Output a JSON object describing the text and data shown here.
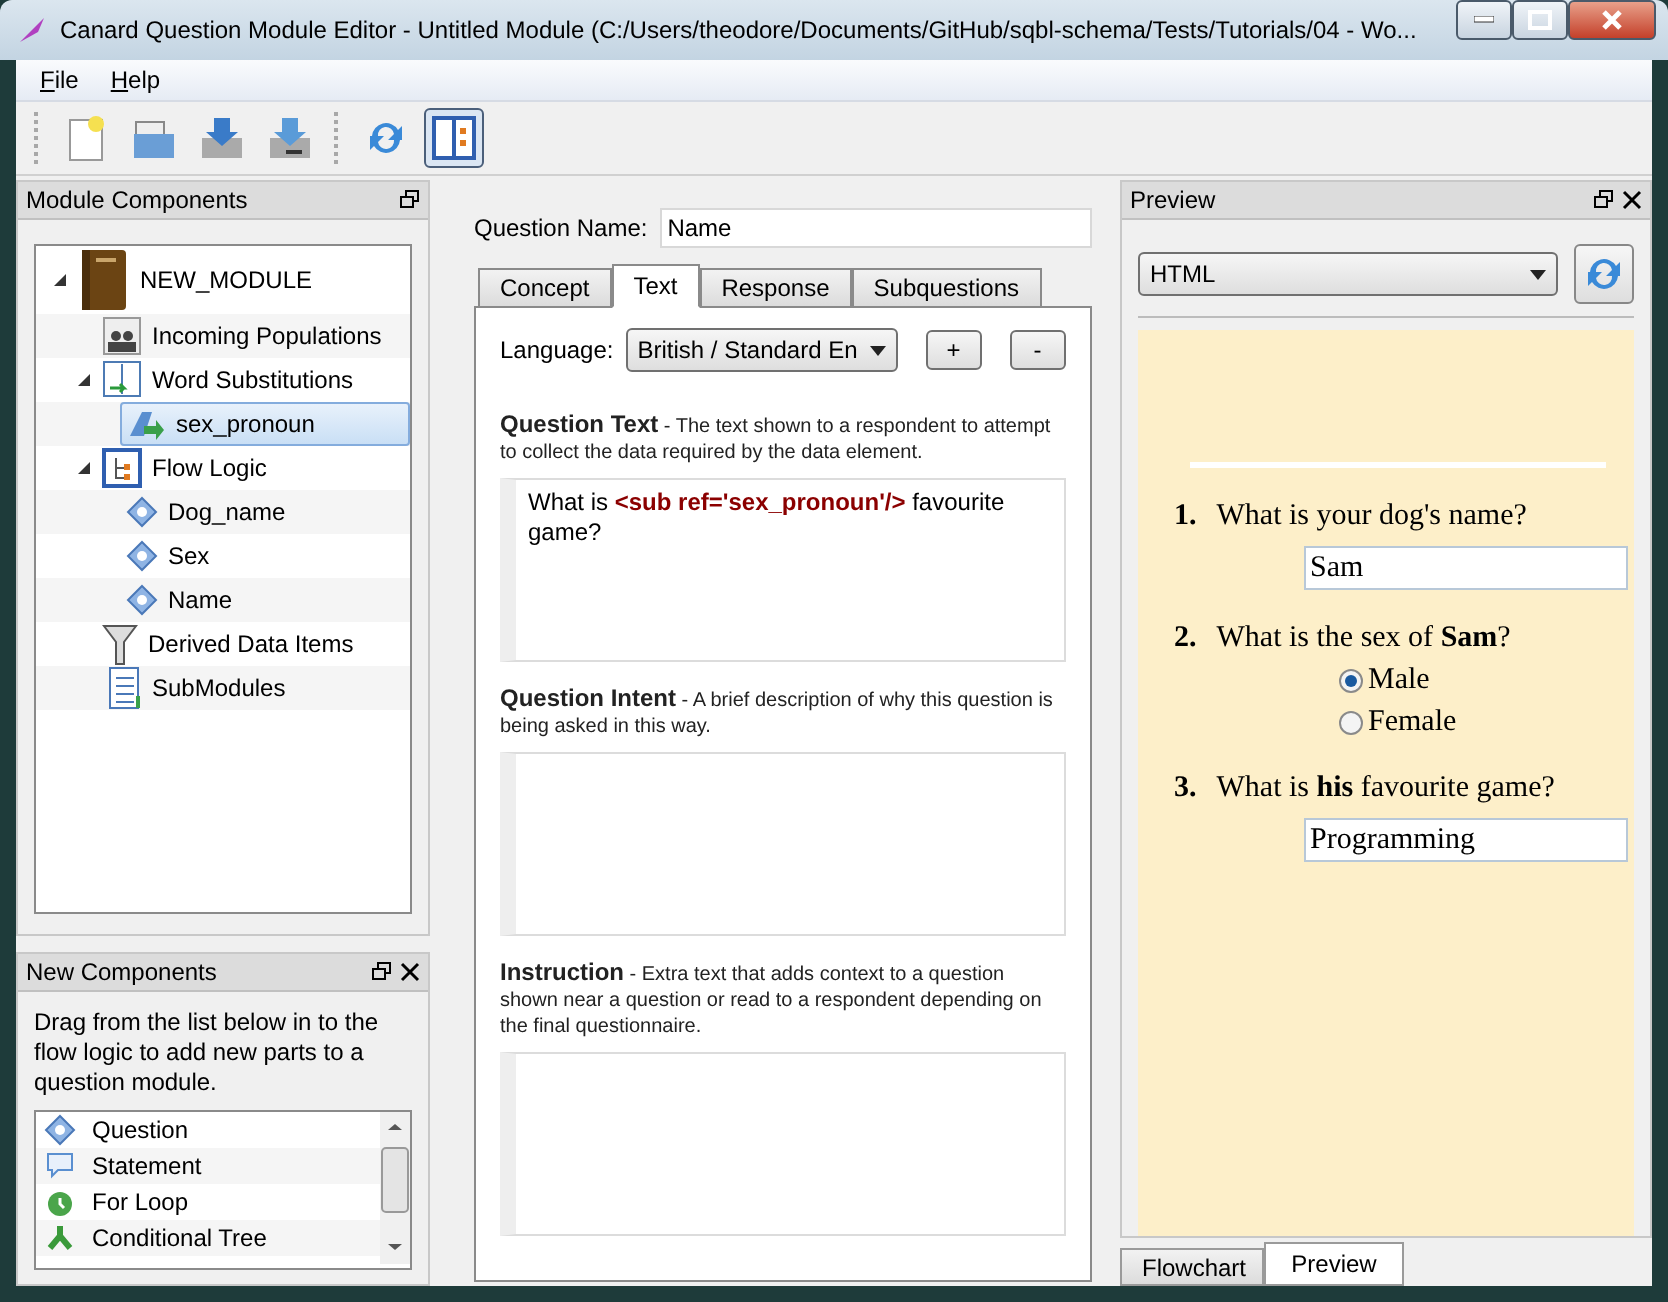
{
  "window": {
    "title": "Canard Question Module Editor - Untitled Module (C:/Users/theodore/Documents/GitHub/sqbl-schema/Tests/Tutorials/04 - Wo..."
  },
  "menu": [
    {
      "label": "File"
    },
    {
      "label": "Help"
    }
  ],
  "toolbar": [
    {
      "kind": "new",
      "selected": false
    },
    {
      "kind": "open",
      "selected": false
    },
    {
      "kind": "save",
      "selected": false
    },
    {
      "kind": "save-as",
      "selected": false
    },
    {
      "kind": "refresh",
      "selected": false
    },
    {
      "kind": "layout",
      "selected": true
    }
  ],
  "module_components": {
    "title": "Module Components",
    "tree": [
      {
        "label": "NEW_MODULE",
        "kind": "module",
        "expanded": true,
        "selected": false,
        "children": [
          {
            "label": "Incoming Populations",
            "kind": "population",
            "selected": false
          },
          {
            "label": "Word Substitutions",
            "kind": "substitutions",
            "expanded": true,
            "selected": false,
            "children": [
              {
                "label": "sex_pronoun",
                "kind": "substitution",
                "selected": true
              }
            ]
          },
          {
            "label": "Flow Logic",
            "kind": "flow",
            "expanded": true,
            "selected": false,
            "children": [
              {
                "label": "Dog_name",
                "kind": "question",
                "selected": false
              },
              {
                "label": "Sex",
                "kind": "question",
                "selected": false
              },
              {
                "label": "Name",
                "kind": "question",
                "selected": false
              }
            ]
          },
          {
            "label": "Derived Data Items",
            "kind": "derived",
            "selected": false
          },
          {
            "label": "SubModules",
            "kind": "submodules",
            "selected": false
          }
        ]
      }
    ]
  },
  "new_components": {
    "title": "New Components",
    "description": "Drag from the list below in to the flow logic to add new parts to a question module.",
    "items": [
      {
        "label": "Question",
        "kind": "question"
      },
      {
        "label": "Statement",
        "kind": "statement"
      },
      {
        "label": "For Loop",
        "kind": "loop"
      },
      {
        "label": "Conditional Tree",
        "kind": "conditional"
      }
    ]
  },
  "editor": {
    "question_name_label": "Question Name:",
    "question_name": "Name",
    "tabs": [
      {
        "label": "Concept",
        "selected": false
      },
      {
        "label": "Text",
        "selected": true
      },
      {
        "label": "Response",
        "selected": false
      },
      {
        "label": "Subquestions",
        "selected": false
      }
    ],
    "language_label": "Language:",
    "language": "British / Standard En",
    "language_buttons": [
      "+",
      "-"
    ],
    "sections": [
      {
        "title": "Question Text",
        "description": "- The text shown to a respondent to attempt to collect the data required by the data element.",
        "value": "What is **<sub ref='sex_pronoun'/>** favourite game?"
      },
      {
        "title": "Question Intent",
        "description": "- A brief description of why this question is being asked in this way."
      },
      {
        "title": "Instruction",
        "description": "- Extra text that adds context to a question shown near a question or read to a respondent depending on the final questionnaire."
      }
    ]
  },
  "preview": {
    "title": "Preview",
    "format": "HTML",
    "questions": [
      {
        "number": "1.",
        "text": "What is your dog's name?",
        "kind": "text",
        "value": "Sam"
      },
      {
        "number": "2.",
        "text": "What is the sex of **Sam**?",
        "kind": "radio",
        "options": [
          {
            "label": "Male",
            "selected": true
          },
          {
            "label": "Female",
            "selected": false
          }
        ]
      },
      {
        "number": "3.",
        "text": "What is **his** favourite game?",
        "kind": "text",
        "value": "Programming"
      }
    ],
    "tabs": [
      {
        "label": "Flowchart",
        "selected": false
      },
      {
        "label": "Preview",
        "selected": true
      }
    ]
  }
}
